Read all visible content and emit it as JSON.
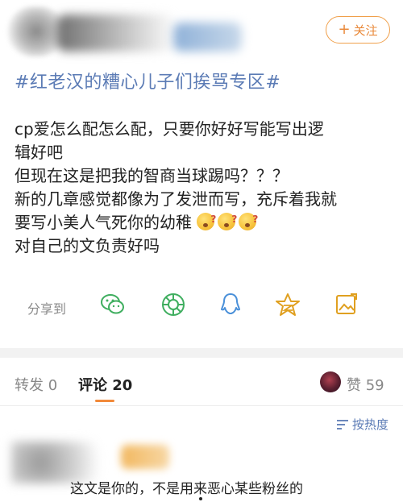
{
  "header": {
    "follow_label": "关注",
    "follow_plus": "+"
  },
  "post": {
    "topic": "#红老汉的糟心儿子们挨骂专区#",
    "lines": [
      "cp爱怎么配怎么配，只要你好好写能写出逻",
      "辑好吧",
      "但现在这是把我的智商当球踢吗？？？",
      "新的几章感觉都像为了发泄而写，充斥着我就",
      "要写小美人气死你的幼稚",
      "对自己的文负责好吗"
    ]
  },
  "share": {
    "label": "分享到",
    "icons": [
      "wechat-icon",
      "moments-icon",
      "qq-icon",
      "qzone-icon",
      "picture-icon"
    ]
  },
  "tabs": {
    "repost_label": "转发",
    "repost_count": "0",
    "comment_label": "评论",
    "comment_count": "20",
    "like_label": "赞",
    "like_count": "59"
  },
  "comments": {
    "sort_label": "按热度",
    "first_text": "这文是你的，不是用来恶心某些粉丝的"
  },
  "colors": {
    "accent_orange": "#f28a3a",
    "link_blue": "#5b7bb5",
    "share_green": "#3fae5f",
    "share_blue": "#4a90d9",
    "share_gold": "#e0a020"
  }
}
